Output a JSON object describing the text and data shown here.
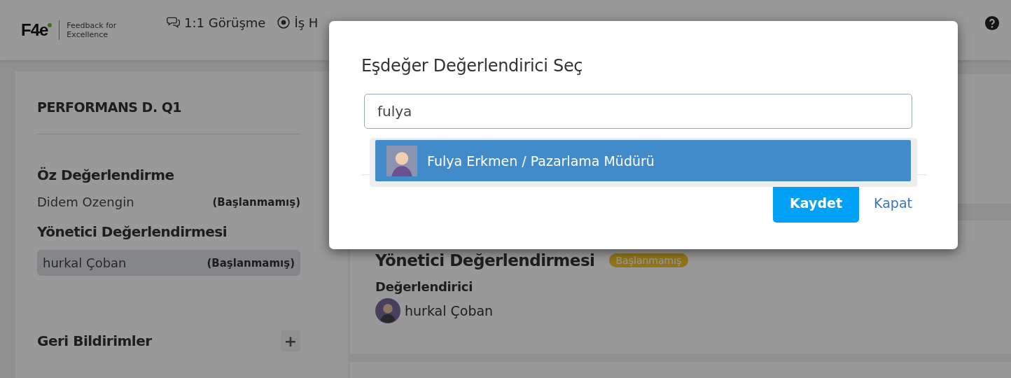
{
  "header": {
    "logo": {
      "mark": "F4e",
      "tagline": "Feedback for Excellence"
    },
    "nav": [
      {
        "label": "1:1 Görüşme"
      },
      {
        "label": "İş H"
      }
    ]
  },
  "sidebar": {
    "title": "PERFORMANS D. Q1",
    "sections": [
      {
        "heading": "Öz Değerlendirme",
        "entries": [
          {
            "name": "Didem Ozengin",
            "status": "(Başlanmamış)",
            "selected": false
          }
        ]
      },
      {
        "heading": "Yönetici Değerlendirmesi",
        "entries": [
          {
            "name": "hurkal Çoban",
            "status": "(Başlanmamış)",
            "selected": true
          }
        ]
      }
    ],
    "feedback": {
      "heading": "Geri Bildirimler",
      "add": "+"
    }
  },
  "detail": {
    "title": "Yönetici Değerlendirmesi",
    "badge": "Başlanmamış",
    "label": "Değerlendirici",
    "evaluator": "hurkal Çoban"
  },
  "modal": {
    "title": "Eşdeğer Değerlendirici Seç",
    "search": {
      "value": "fulya"
    },
    "results": [
      {
        "label": "Fulya Erkmen / Pazarlama Müdürü",
        "selected": true
      }
    ],
    "buttons": {
      "save": "Kaydet",
      "close": "Kapat"
    }
  }
}
